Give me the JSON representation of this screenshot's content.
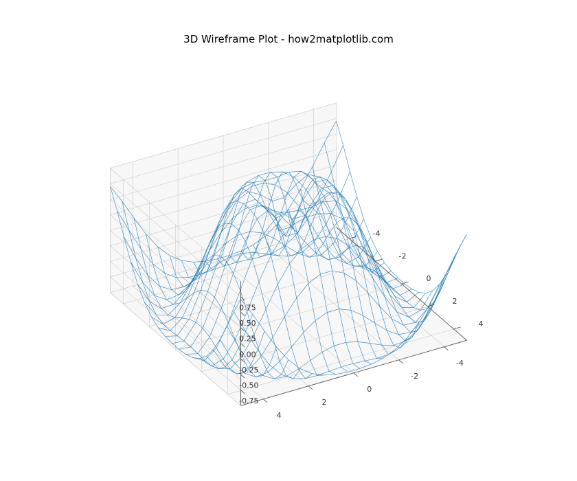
{
  "chart_data": {
    "type": "3d-wireframe",
    "title": "3D Wireframe Plot - how2matplotlib.com",
    "function": "z = sin(sqrt(x^2 + y^2))",
    "x_range": [
      -5,
      5
    ],
    "y_range": [
      -5,
      5
    ],
    "z_range": [
      -1,
      1
    ],
    "x_ticks": [
      -4,
      -2,
      0,
      2,
      4
    ],
    "y_ticks": [
      -4,
      -2,
      0,
      2,
      4
    ],
    "z_ticks": [
      -0.75,
      -0.5,
      -0.25,
      0.0,
      0.25,
      0.5,
      0.75
    ],
    "x_values": [
      -5.0,
      -4.474,
      -3.947,
      -3.421,
      -2.895,
      -2.368,
      -1.842,
      -1.316,
      -0.789,
      -0.263,
      0.263,
      0.789,
      1.316,
      1.842,
      2.368,
      2.895,
      3.421,
      3.947,
      4.474,
      5.0
    ],
    "y_values": [
      -5.0,
      -4.474,
      -3.947,
      -3.421,
      -2.895,
      -2.368,
      -1.842,
      -1.316,
      -0.789,
      -0.263,
      0.263,
      0.789,
      1.316,
      1.842,
      2.368,
      2.895,
      3.421,
      3.947,
      4.474,
      5.0
    ],
    "wire_color": "#1f77b4",
    "pane_color": "#f7f7f7",
    "grid_color": "#cccccc"
  }
}
